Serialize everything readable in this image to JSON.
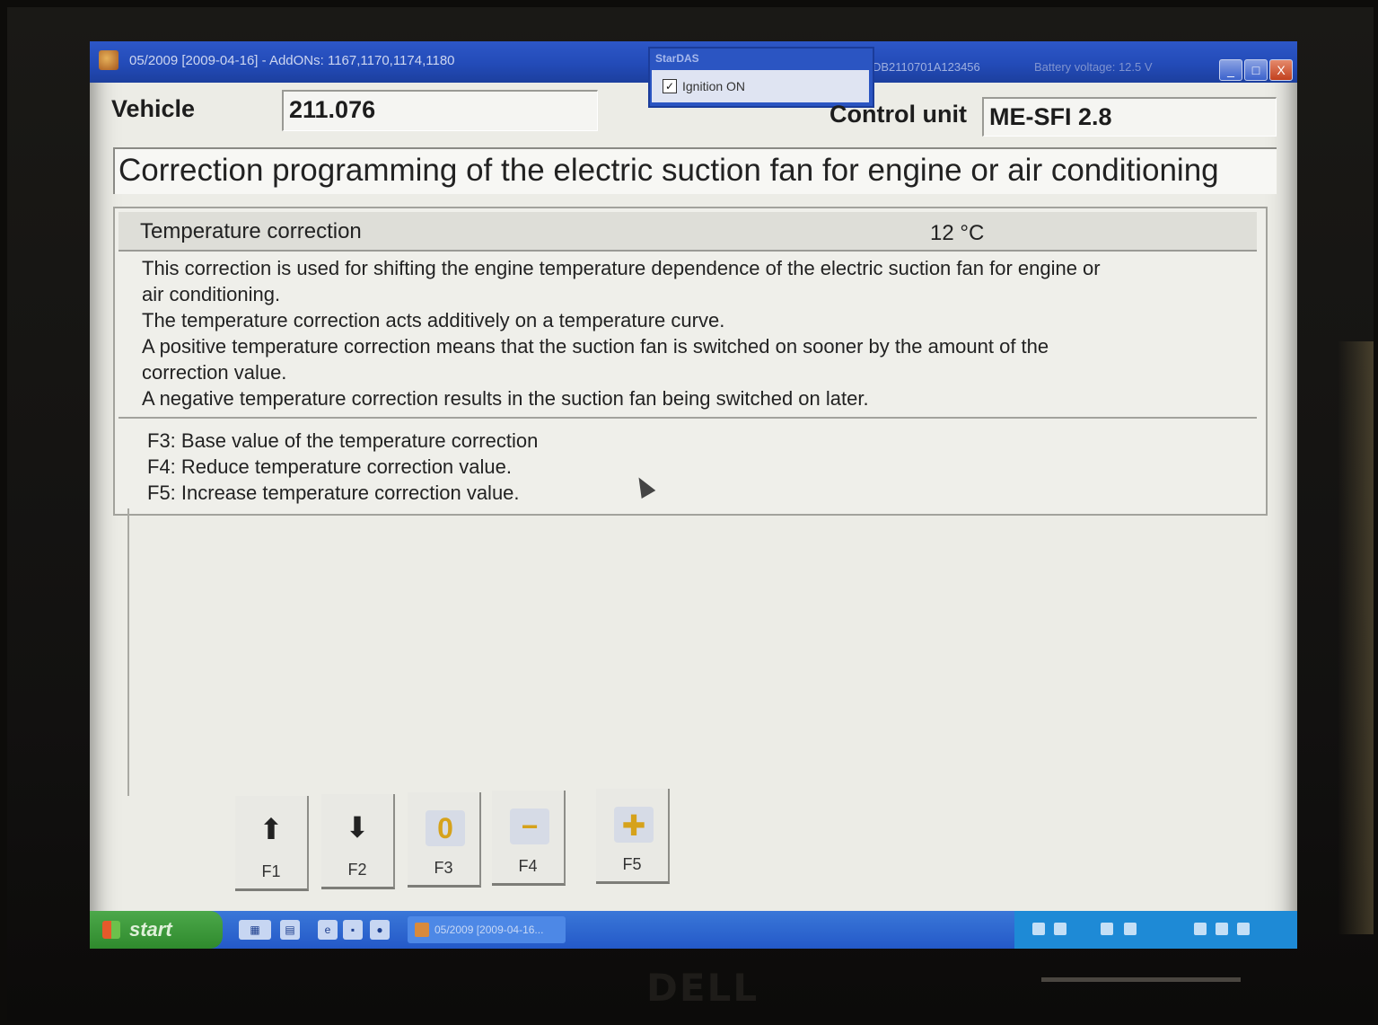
{
  "window": {
    "title": "05/2009 [2009-04-16] - AddONs: 1167,1170,1174,1180",
    "vin": "DB2110701A123456",
    "battery": "Battery voltage: 12.5 V",
    "buttons": {
      "minimize": "_",
      "maximize": "□",
      "close": "X"
    }
  },
  "popup": {
    "title": "StarDAS",
    "checkbox_label": "Ignition ON",
    "checked": true
  },
  "vehicle": {
    "label": "Vehicle",
    "value": "211.076"
  },
  "control_unit": {
    "label": "Control unit",
    "value": "ME-SFI 2.8"
  },
  "heading": "Correction programming of the electric suction fan for engine or air conditioning",
  "parameter": {
    "name": "Temperature correction",
    "value": "12 °C"
  },
  "description": [
    "This correction is used for shifting the engine temperature dependence of the electric suction fan for engine or",
    "air conditioning.",
    "The temperature correction acts additively on a temperature curve.",
    "A positive temperature correction means that the suction fan is switched on sooner by the amount of the",
    "correction value.",
    "A negative temperature correction results in the suction fan being switched on later."
  ],
  "hints": [
    "F3: Base value of the temperature correction",
    "F4: Reduce temperature correction value.",
    "F5: Increase temperature correction value."
  ],
  "function_keys": [
    {
      "key": "F1",
      "icon": "arrow-up-icon",
      "glyph": "⬆"
    },
    {
      "key": "F2",
      "icon": "arrow-down-icon",
      "glyph": "⬇"
    },
    {
      "key": "F3",
      "icon": "reset-zero-icon",
      "glyph": "0"
    },
    {
      "key": "F4",
      "icon": "minus-icon",
      "glyph": "−"
    },
    {
      "key": "F5",
      "icon": "plus-icon",
      "glyph": "✚"
    }
  ],
  "taskbar": {
    "start_label": "start",
    "task_label": "05/2009 [2009-04-16..."
  },
  "device": {
    "brand": "DELL"
  },
  "colors": {
    "titlebar": "#234bb8",
    "taskbar": "#2459c8",
    "start": "#2f8a2d",
    "fkey_accent": "#d6a21b"
  }
}
